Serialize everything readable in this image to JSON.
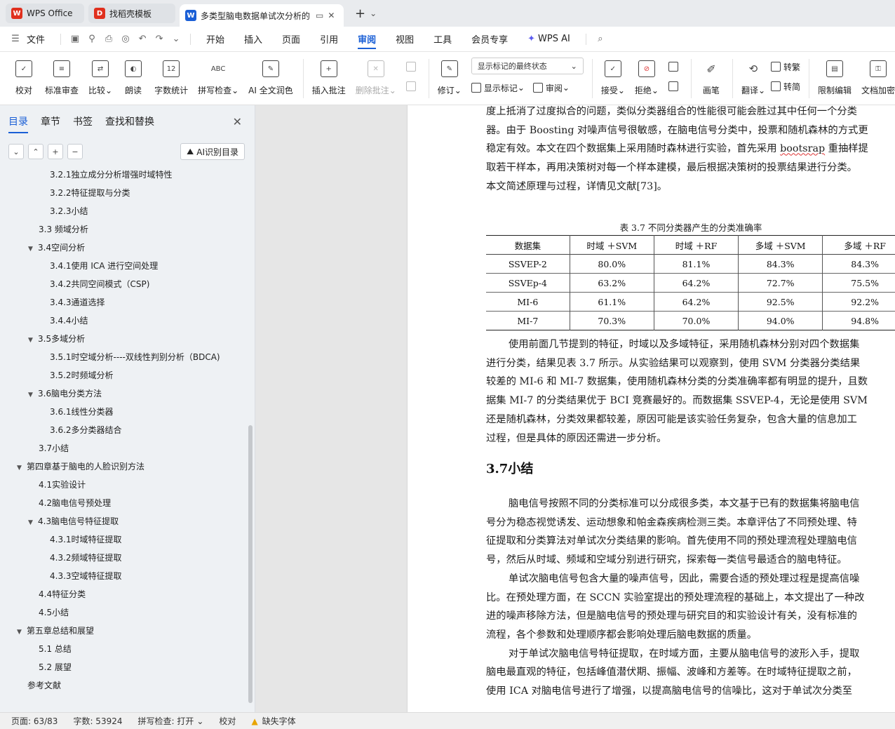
{
  "tabs": [
    {
      "label": "WPS Office",
      "icon": "wps-logo-icon",
      "color": "#e0301e"
    },
    {
      "label": "找稻壳模板",
      "icon": "docer-icon",
      "color": "#e0301e"
    },
    {
      "label": "多类型脑电数据单试次分析的",
      "icon": "word-doc-icon",
      "color": "#1a5fd6"
    }
  ],
  "menu": {
    "file": "文件",
    "items": [
      "开始",
      "插入",
      "页面",
      "引用",
      "审阅",
      "视图",
      "工具",
      "会员专享"
    ],
    "active": "审阅",
    "wps_ai": "WPS AI"
  },
  "ribbon": {
    "proof": "校对",
    "standard_review": "标准审查",
    "compare": "比较",
    "read_aloud": "朗读",
    "word_count": "字数统计",
    "spell_check": "拼写检查",
    "ai_polish": "AI 全文润色",
    "insert_comment": "插入批注",
    "delete_comment": "删除批注",
    "track_changes": "修订",
    "markup_display": "显示标记的最终状态",
    "show_markup": "显示标记",
    "review_pane": "审阅",
    "accept": "接受",
    "reject": "拒绝",
    "ink": "画笔",
    "translate": "翻译",
    "to_traditional": "转繁",
    "to_simplified": "转简",
    "restrict_edit": "限制编辑",
    "doc_encrypt": "文档加密"
  },
  "nav": {
    "tabs": [
      "目录",
      "章节",
      "书签",
      "查找和替换"
    ],
    "active_tab": "目录",
    "ai_button": "AI识别目录",
    "toc": [
      {
        "label": "3.2.1独立成分分析增强时域特性",
        "level": 3,
        "arrow": false
      },
      {
        "label": "3.2.2特征提取与分类",
        "level": 3,
        "arrow": false
      },
      {
        "label": "3.2.3小结",
        "level": 3,
        "arrow": false
      },
      {
        "label": "3.3 频域分析",
        "level": 2,
        "arrow": false
      },
      {
        "label": "3.4空间分析",
        "level": 2,
        "arrow": true
      },
      {
        "label": "3.4.1使用 ICA 进行空间处理",
        "level": 3,
        "arrow": false
      },
      {
        "label": "3.4.2共同空间模式（CSP)",
        "level": 3,
        "arrow": false
      },
      {
        "label": "3.4.3通道选择",
        "level": 3,
        "arrow": false
      },
      {
        "label": "3.4.4小结",
        "level": 3,
        "arrow": false
      },
      {
        "label": "3.5多域分析",
        "level": 2,
        "arrow": true
      },
      {
        "label": "3.5.1时空域分析----双线性判别分析（BDCA)",
        "level": 3,
        "arrow": false
      },
      {
        "label": "3.5.2时频域分析",
        "level": 3,
        "arrow": false
      },
      {
        "label": "3.6脑电分类方法",
        "level": 2,
        "arrow": true
      },
      {
        "label": "3.6.1线性分类器",
        "level": 3,
        "arrow": false
      },
      {
        "label": "3.6.2多分类器结合",
        "level": 3,
        "arrow": false
      },
      {
        "label": "3.7小结",
        "level": 2,
        "arrow": false
      },
      {
        "label": "第四章基于脑电的人脸识别方法",
        "level": 1,
        "arrow": true
      },
      {
        "label": "4.1实验设计",
        "level": 2,
        "arrow": false
      },
      {
        "label": "4.2脑电信号预处理",
        "level": 2,
        "arrow": false
      },
      {
        "label": "4.3脑电信号特征提取",
        "level": 2,
        "arrow": true
      },
      {
        "label": "4.3.1时域特征提取",
        "level": 3,
        "arrow": false
      },
      {
        "label": "4.3.2频域特征提取",
        "level": 3,
        "arrow": false
      },
      {
        "label": "4.3.3空域特征提取",
        "level": 3,
        "arrow": false
      },
      {
        "label": "4.4特征分类",
        "level": 2,
        "arrow": false
      },
      {
        "label": "4.5小结",
        "level": 2,
        "arrow": false
      },
      {
        "label": "第五章总结和展望",
        "level": 1,
        "arrow": true
      },
      {
        "label": "5.1 总结",
        "level": 2,
        "arrow": false
      },
      {
        "label": "5.2 展望",
        "level": 2,
        "arrow": false
      },
      {
        "label": "参考文献",
        "level": 1,
        "arrow": false
      }
    ]
  },
  "doc": {
    "para1": [
      "度上抵消了过度拟合的问题，类似分类器组合的性能很可能会胜过其中任何一个分类",
      "器。由于 Boosting 对噪声信号很敏感，在脑电信号分类中，投票和随机森林的方式更",
      "稳定有效。本文在四个数据集上采用随时森林进行实验，首先采用 bootsrap 重抽样提",
      "取若干样本，再用决策树对每一个样本建模，最后根据决策树的投票结果进行分类。",
      "本文简述原理与过程，详情见文献[73]。"
    ],
    "table_caption": "表 3.7 不同分类器产生的分类准确率",
    "table": {
      "headers": [
        "数据集",
        "时域 ＋SVM",
        "时域 ＋RF",
        "多域 ＋SVM",
        "多域 ＋RF"
      ],
      "rows": [
        [
          "SSVEP-2",
          "80.0%",
          "81.1%",
          "84.3%",
          "84.3%"
        ],
        [
          "SSVEp-4",
          "63.2%",
          "64.2%",
          "72.7%",
          "75.5%"
        ],
        [
          "MI-6",
          "61.1%",
          "64.2%",
          "92.5%",
          "92.2%"
        ],
        [
          "MI-7",
          "70.3%",
          "70.0%",
          "94.0%",
          "94.8%"
        ]
      ]
    },
    "para2": [
      "使用前面几节提到的特征，时域以及多域特征，采用随机森林分别对四个数据集",
      "进行分类，结果见表 3.7 所示。从实验结果可以观察到，使用 SVM 分类器分类结果",
      "较差的 MI-6 和 MI-7 数据集，使用随机森林分类的分类准确率都有明显的提升，且数",
      "据集 MI-7 的分类结果优于 BCI 竞赛最好的。而数据集 SSVEP-4，无论是使用 SVM",
      "还是随机森林，分类效果都较差，原因可能是该实验任务复杂，包含大量的信息加工",
      "过程，但是具体的原因还需进一步分析。"
    ],
    "section_title": "3.7小结",
    "para3": [
      "脑电信号按照不同的分类标准可以分成很多类，本文基于已有的数据集将脑电信",
      "号分为稳态视觉诱发、运动想象和帕金森疾病检测三类。本章评估了不同预处理、特",
      "征提取和分类算法对单试次分类结果的影响。首先使用不同的预处理流程处理脑电信",
      "号，然后从时域、频域和空域分别进行研究，探索每一类信号最适合的脑电特征。",
      "单试次脑电信号包含大量的噪声信号，因此，需要合适的预处理过程是提高信噪",
      "比。在预处理方面，在 SCCN 实验室提出的预处理流程的基础上，本文提出了一种改",
      "进的噪声移除方法，但是脑电信号的预处理与研究目的和实验设计有关，没有标准的",
      "流程，各个参数和处理顺序都会影响处理后脑电数据的质量。",
      "对于单试次脑电信号特征提取，在时域方面，主要从脑电信号的波形入手，提取",
      "脑电最直观的特征，包括峰值潜伏期、振幅、波峰和方差等。在时域特征提取之前，",
      "使用 ICA 对脑电信号进行了增强，以提高脑电信号的信噪比，这对于单试次分类至"
    ]
  },
  "status": {
    "page": "页面: 63/83",
    "words": "字数: 53924",
    "spell": "拼写检查: 打开",
    "proof": "校对",
    "missing_font": "缺失字体"
  },
  "colors": {
    "accent": "#1a5fd6",
    "warning": "#e8a400"
  }
}
